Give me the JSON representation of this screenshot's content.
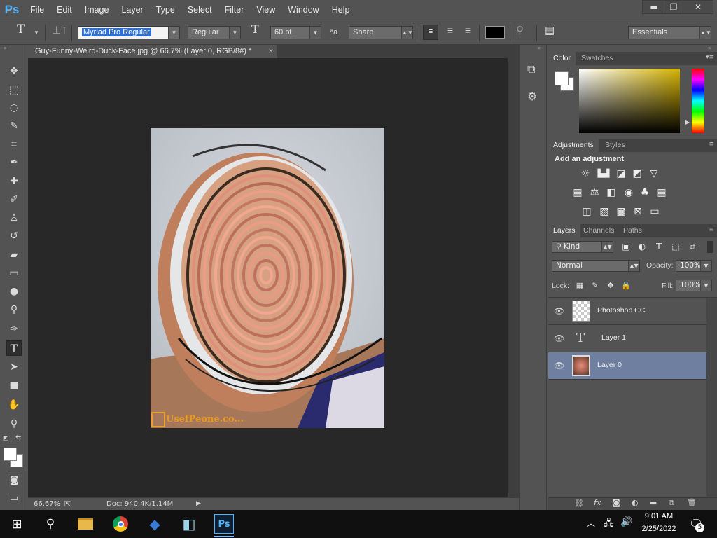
{
  "app": {
    "logo": "Ps"
  },
  "menu": [
    "File",
    "Edit",
    "Image",
    "Layer",
    "Type",
    "Select",
    "Filter",
    "View",
    "Window",
    "Help"
  ],
  "window_controls": {
    "minimize": "▬",
    "restore": "❐",
    "close": "✕"
  },
  "options": {
    "font_family": "Myriad Pro Regular",
    "font_style": "Regular",
    "font_size": "60 pt",
    "antialias": "Sharp",
    "aa_label": "ªa",
    "text_color": "#000000",
    "workspace": "Essentials"
  },
  "document": {
    "tab_title": "Guy-Funny-Weird-Duck-Face.jpg @ 66.7% (Layer 0, RGB/8#) *",
    "close": "×",
    "zoom": "66.67%",
    "doc_info": "Doc: 940.4K/1.14M",
    "watermark": "UsefPeone.co..."
  },
  "panels": {
    "color_tabs": [
      "Color",
      "Swatches"
    ],
    "adjust_tabs": [
      "Adjustments",
      "Styles"
    ],
    "adjust_title": "Add an adjustment",
    "layers_tabs": [
      "Layers",
      "Channels",
      "Paths"
    ],
    "filter_kind": "Kind",
    "blend_mode": "Normal",
    "opacity_label": "Opacity:",
    "opacity_value": "100%",
    "lock_label": "Lock:",
    "fill_label": "Fill:",
    "fill_value": "100%",
    "layers": [
      {
        "name": "Photoshop CC",
        "type": "smart",
        "selected": false
      },
      {
        "name": "Layer 1",
        "type": "text",
        "selected": false
      },
      {
        "name": "Layer 0",
        "type": "image",
        "selected": true
      }
    ]
  },
  "taskbar": {
    "time": "9:01 AM",
    "date": "2/25/2022",
    "notifications": "5"
  },
  "colors": {
    "ui_bg": "#535353",
    "selected_layer": "#6f7f9f",
    "ps_blue": "#4fb3ff"
  }
}
